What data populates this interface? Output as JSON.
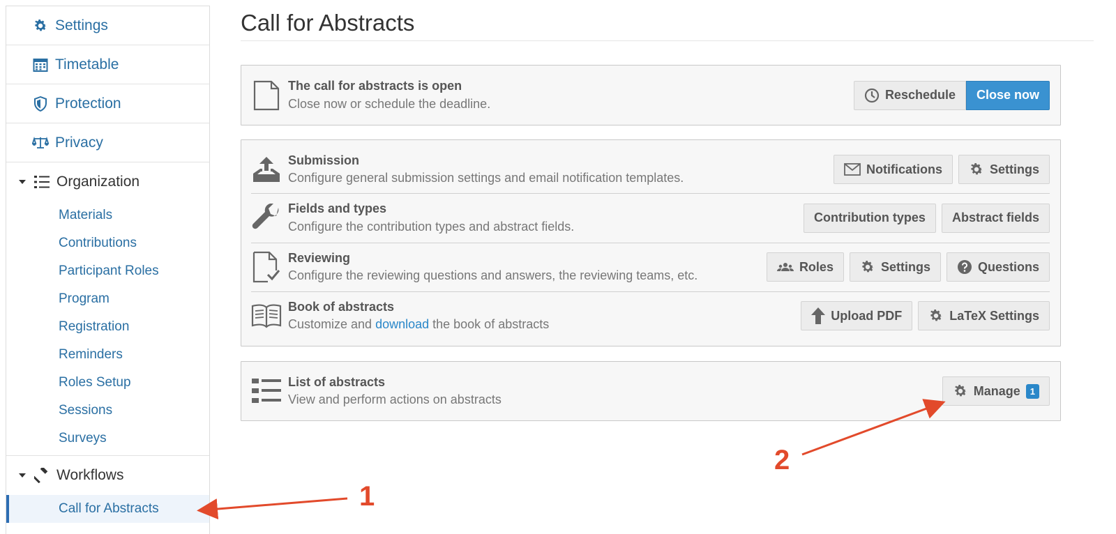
{
  "sidebar": {
    "top_items": [
      {
        "label": "Settings",
        "icon": "gear-icon"
      },
      {
        "label": "Timetable",
        "icon": "calendar-icon"
      },
      {
        "label": "Protection",
        "icon": "shield-icon"
      },
      {
        "label": "Privacy",
        "icon": "scale-icon"
      }
    ],
    "groups": [
      {
        "label": "Organization",
        "icon": "list-icon",
        "items": [
          "Materials",
          "Contributions",
          "Participant Roles",
          "Program",
          "Registration",
          "Reminders",
          "Roles Setup",
          "Sessions",
          "Surveys"
        ]
      },
      {
        "label": "Workflows",
        "icon": "gavel-icon",
        "items": [
          "Call for Abstracts"
        ],
        "active_item": "Call for Abstracts"
      }
    ]
  },
  "main": {
    "title": "Call for Abstracts",
    "status": {
      "title": "The call for abstracts is open",
      "desc": "Close now or schedule the deadline.",
      "reschedule_label": "Reschedule",
      "close_label": "Close now"
    },
    "config_rows": [
      {
        "title": "Submission",
        "desc": "Configure general submission settings and email notification templates.",
        "buttons": [
          "Notifications",
          "Settings"
        ]
      },
      {
        "title": "Fields and types",
        "desc": "Configure the contribution types and abstract fields.",
        "buttons": [
          "Contribution types",
          "Abstract fields"
        ]
      },
      {
        "title": "Reviewing",
        "desc": "Configure the reviewing questions and answers, the reviewing teams, etc.",
        "buttons": [
          "Roles",
          "Settings",
          "Questions"
        ]
      },
      {
        "title": "Book of abstracts",
        "desc_before": "Customize and ",
        "desc_link": "download",
        "desc_after": " the book of abstracts",
        "buttons": [
          "Upload PDF",
          "LaTeX Settings"
        ]
      }
    ],
    "list": {
      "title": "List of abstracts",
      "desc": "View and perform actions on abstracts",
      "manage_label": "Manage",
      "manage_badge": "1"
    }
  },
  "annotations": {
    "label_1": "1",
    "label_2": "2",
    "color": "#e24a2b"
  },
  "colors": {
    "link": "#2a6fa3",
    "primary_button": "#3a92d1",
    "active_bg": "#eef4fb"
  }
}
